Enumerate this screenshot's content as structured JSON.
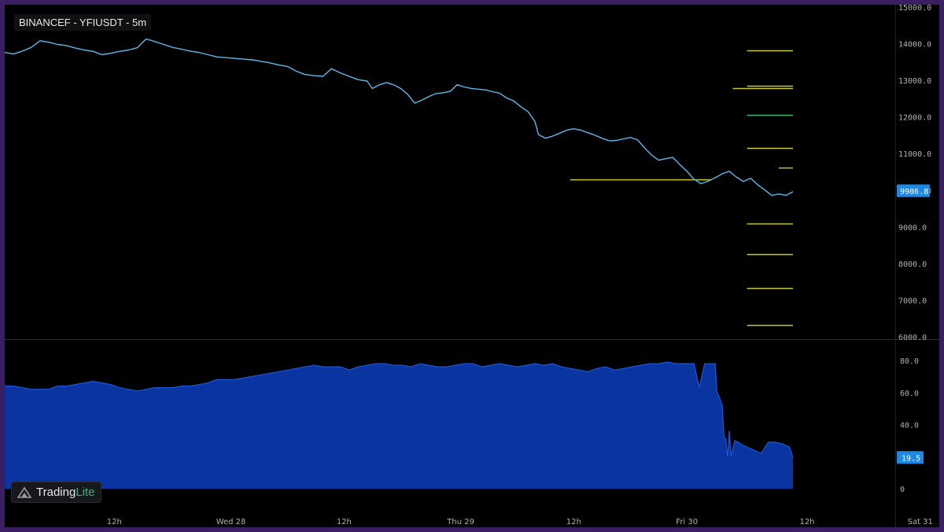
{
  "title": "BINANCEF - YFIUSDT - 5m",
  "branding": {
    "name_part1": "Trading",
    "name_part2": "Lite"
  },
  "colors": {
    "background": "#000000",
    "frame": "#3a2063",
    "price_line": "#5bb8e8",
    "price_badge": "#1e88e5",
    "indicator_fill": "#0a35a0",
    "indicator_edge": "#1f55d6",
    "level_yellow": "#c8c832",
    "level_green": "#3cb371",
    "axis_text": "#b0b0b0"
  },
  "chart_data": [
    {
      "type": "line",
      "panel": "price",
      "ylim": [
        6000,
        15000
      ],
      "y_ticks": [
        "15000.0",
        "14000.0",
        "13000.0",
        "12000.0",
        "11000.0",
        "10000.0",
        "9000.0",
        "8000.0",
        "7000.0",
        "6000.0"
      ],
      "last_value_label": "9986.8",
      "last_value": 9986.8,
      "series": [
        {
          "points": [
            [
              0,
              13760
            ],
            [
              5,
              13720
            ],
            [
              10,
              13800
            ],
            [
              15,
              13900
            ],
            [
              20,
              14080
            ],
            [
              25,
              14040
            ],
            [
              30,
              13980
            ],
            [
              35,
              13950
            ],
            [
              40,
              13880
            ],
            [
              45,
              13830
            ],
            [
              50,
              13790
            ],
            [
              55,
              13700
            ],
            [
              60,
              13740
            ],
            [
              65,
              13790
            ],
            [
              70,
              13830
            ],
            [
              75,
              13890
            ],
            [
              80,
              14130
            ],
            [
              85,
              14060
            ],
            [
              90,
              13980
            ],
            [
              95,
              13900
            ],
            [
              100,
              13850
            ],
            [
              105,
              13800
            ],
            [
              110,
              13760
            ],
            [
              115,
              13700
            ],
            [
              120,
              13640
            ],
            [
              125,
              13620
            ],
            [
              130,
              13600
            ],
            [
              135,
              13580
            ],
            [
              140,
              13560
            ],
            [
              145,
              13520
            ],
            [
              150,
              13480
            ],
            [
              155,
              13420
            ],
            [
              160,
              13380
            ],
            [
              165,
              13250
            ],
            [
              170,
              13160
            ],
            [
              175,
              13130
            ],
            [
              180,
              13110
            ],
            [
              185,
              13320
            ],
            [
              190,
              13200
            ],
            [
              195,
              13110
            ],
            [
              200,
              13020
            ],
            [
              205,
              12980
            ],
            [
              208,
              12780
            ],
            [
              212,
              12880
            ],
            [
              216,
              12940
            ],
            [
              220,
              12880
            ],
            [
              224,
              12780
            ],
            [
              228,
              12620
            ],
            [
              232,
              12380
            ],
            [
              236,
              12460
            ],
            [
              240,
              12560
            ],
            [
              244,
              12640
            ],
            [
              248,
              12660
            ],
            [
              252,
              12700
            ],
            [
              256,
              12880
            ],
            [
              260,
              12820
            ],
            [
              264,
              12780
            ],
            [
              268,
              12760
            ],
            [
              272,
              12740
            ],
            [
              276,
              12690
            ],
            [
              280,
              12650
            ],
            [
              284,
              12520
            ],
            [
              288,
              12440
            ],
            [
              292,
              12280
            ],
            [
              296,
              12150
            ],
            [
              300,
              11880
            ],
            [
              302,
              11520
            ],
            [
              306,
              11420
            ],
            [
              310,
              11480
            ],
            [
              314,
              11560
            ],
            [
              318,
              11640
            ],
            [
              322,
              11680
            ],
            [
              326,
              11640
            ],
            [
              330,
              11570
            ],
            [
              334,
              11500
            ],
            [
              338,
              11420
            ],
            [
              342,
              11350
            ],
            [
              346,
              11360
            ],
            [
              350,
              11400
            ],
            [
              354,
              11440
            ],
            [
              358,
              11380
            ],
            [
              362,
              11160
            ],
            [
              366,
              10960
            ],
            [
              370,
              10820
            ],
            [
              374,
              10860
            ],
            [
              378,
              10900
            ],
            [
              382,
              10700
            ],
            [
              386,
              10520
            ],
            [
              390,
              10300
            ],
            [
              394,
              10180
            ],
            [
              398,
              10250
            ],
            [
              402,
              10340
            ],
            [
              406,
              10450
            ],
            [
              410,
              10520
            ],
            [
              414,
              10360
            ],
            [
              418,
              10240
            ],
            [
              422,
              10330
            ],
            [
              426,
              10150
            ],
            [
              430,
              10010
            ],
            [
              434,
              9860
            ],
            [
              438,
              9900
            ],
            [
              442,
              9860
            ],
            [
              446,
              9960
            ]
          ]
        }
      ],
      "levels": [
        {
          "value": 13820,
          "x0": 420,
          "x1": 446,
          "color": "yellow"
        },
        {
          "value": 12860,
          "x0": 420,
          "x1": 446,
          "color": "yellow"
        },
        {
          "value": 12790,
          "x0": 412,
          "x1": 446,
          "color": "yellow"
        },
        {
          "value": 12050,
          "x0": 420,
          "x1": 446,
          "color": "green"
        },
        {
          "value": 11150,
          "x0": 420,
          "x1": 446,
          "color": "yellow"
        },
        {
          "value": 10620,
          "x0": 438,
          "x1": 446,
          "color": "yellow"
        },
        {
          "value": 10290,
          "x0": 320,
          "x1": 400,
          "color": "yellow"
        },
        {
          "value": 9090,
          "x0": 420,
          "x1": 446,
          "color": "yellow"
        },
        {
          "value": 8260,
          "x0": 420,
          "x1": 446,
          "color": "yellow"
        },
        {
          "value": 7330,
          "x0": 420,
          "x1": 446,
          "color": "yellow"
        },
        {
          "value": 6320,
          "x0": 420,
          "x1": 446,
          "color": "yellow"
        }
      ]
    },
    {
      "type": "area",
      "panel": "indicator",
      "ylim": [
        0,
        84
      ],
      "y_ticks": [
        "80.0",
        "60.0",
        "40.0",
        "0"
      ],
      "y_tick_values": [
        80,
        60,
        40,
        0
      ],
      "last_value_label": "19.5",
      "last_value": 19.5,
      "series": [
        {
          "points": [
            [
              0,
              64
            ],
            [
              5,
              64
            ],
            [
              10,
              63
            ],
            [
              15,
              62
            ],
            [
              20,
              62
            ],
            [
              25,
              62
            ],
            [
              30,
              64
            ],
            [
              35,
              64
            ],
            [
              40,
              65
            ],
            [
              45,
              66
            ],
            [
              50,
              67
            ],
            [
              55,
              66
            ],
            [
              60,
              65
            ],
            [
              65,
              63
            ],
            [
              70,
              62
            ],
            [
              75,
              61
            ],
            [
              80,
              62
            ],
            [
              85,
              63
            ],
            [
              90,
              63
            ],
            [
              95,
              63
            ],
            [
              100,
              64
            ],
            [
              105,
              64
            ],
            [
              110,
              65
            ],
            [
              115,
              66
            ],
            [
              120,
              68
            ],
            [
              125,
              68
            ],
            [
              130,
              68
            ],
            [
              135,
              69
            ],
            [
              140,
              70
            ],
            [
              145,
              71
            ],
            [
              150,
              72
            ],
            [
              155,
              73
            ],
            [
              160,
              74
            ],
            [
              165,
              75
            ],
            [
              170,
              76
            ],
            [
              175,
              77
            ],
            [
              180,
              76
            ],
            [
              185,
              76
            ],
            [
              190,
              76
            ],
            [
              195,
              74
            ],
            [
              200,
              76
            ],
            [
              205,
              77
            ],
            [
              210,
              78
            ],
            [
              215,
              78
            ],
            [
              220,
              77
            ],
            [
              225,
              77
            ],
            [
              230,
              76
            ],
            [
              235,
              78
            ],
            [
              240,
              77
            ],
            [
              245,
              76
            ],
            [
              250,
              76
            ],
            [
              255,
              77
            ],
            [
              260,
              78
            ],
            [
              265,
              78
            ],
            [
              270,
              76
            ],
            [
              275,
              77
            ],
            [
              280,
              78
            ],
            [
              285,
              77
            ],
            [
              290,
              76
            ],
            [
              295,
              77
            ],
            [
              300,
              78
            ],
            [
              305,
              77
            ],
            [
              310,
              78
            ],
            [
              315,
              76
            ],
            [
              320,
              75
            ],
            [
              325,
              74
            ],
            [
              330,
              73
            ],
            [
              335,
              75
            ],
            [
              340,
              76
            ],
            [
              345,
              74
            ],
            [
              350,
              75
            ],
            [
              355,
              76
            ],
            [
              360,
              77
            ],
            [
              365,
              78
            ],
            [
              370,
              78
            ],
            [
              375,
              79
            ],
            [
              380,
              78
            ],
            [
              385,
              78
            ],
            [
              390,
              78
            ],
            [
              393,
              63
            ],
            [
              396,
              78
            ],
            [
              399,
              78
            ],
            [
              402,
              78
            ],
            [
              403,
              60
            ],
            [
              404,
              58
            ],
            [
              406,
              52
            ],
            [
              407,
              32
            ],
            [
              408,
              31
            ],
            [
              409,
              20
            ],
            [
              410,
              36
            ],
            [
              411,
              20
            ],
            [
              413,
              30
            ],
            [
              415,
              29
            ],
            [
              418,
              27
            ],
            [
              420,
              26
            ],
            [
              424,
              24
            ],
            [
              428,
              22
            ],
            [
              432,
              29
            ],
            [
              436,
              29
            ],
            [
              440,
              28
            ],
            [
              444,
              26
            ],
            [
              446,
              19.5
            ]
          ]
        }
      ]
    }
  ],
  "x_ticks": [
    "12h",
    "Wed 28",
    "12h",
    "Thu 29",
    "12h",
    "Fri 30",
    "12h",
    "Sat 31"
  ],
  "x_tick_values": [
    62,
    128,
    192,
    258,
    322,
    386,
    454,
    518
  ],
  "x_range": [
    0,
    600
  ]
}
